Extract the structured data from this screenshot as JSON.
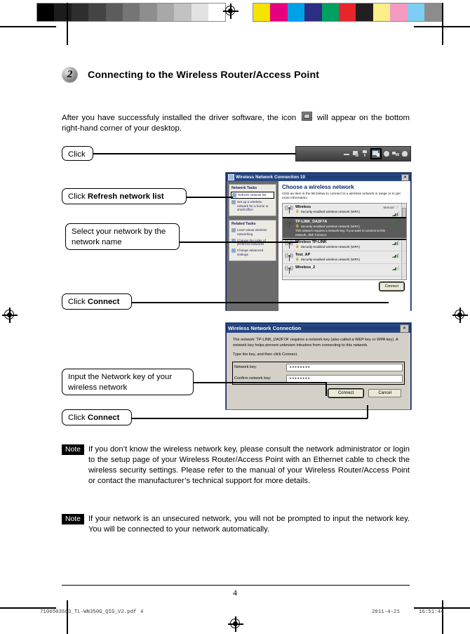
{
  "calibration": {
    "gray_swatches": [
      "#000000",
      "#1c1c1c",
      "#2e2e2e",
      "#444444",
      "#5c5c5c",
      "#757575",
      "#8e8e8e",
      "#a8a8a8",
      "#c2c2c2",
      "#e2e2e2",
      "#ffffff"
    ],
    "color_swatches": [
      "#f5e400",
      "#e5007f",
      "#00a0e9",
      "#2b2e83",
      "#00a060",
      "#e7262b",
      "#231f20",
      "#fbeE88",
      "#f49ac1",
      "#7ecef4",
      "#8c8c8c"
    ]
  },
  "section": {
    "number": "2",
    "title": "Connecting to the Wireless Router/Access Point"
  },
  "intro": {
    "before_icon": "After you have successfuly installed the driver software, the icon",
    "after_icon": "will appear on the bottom right-hand corner of your desktop."
  },
  "callouts": {
    "click_tray": "Click",
    "refresh_prefix": "Click ",
    "refresh_bold": "Refresh network list",
    "select_network": "Select your network by the network name",
    "connect1_prefix": "Click ",
    "connect1_bold": "Connect",
    "input_key": "Input the Network key of your wireless network",
    "connect2_prefix": "Click ",
    "connect2_bold": "Connect"
  },
  "browse_dialog": {
    "title": "Wireless Network Connection 10",
    "close_label": "×",
    "sidebar": {
      "group1_title": "Network Tasks",
      "group1_items": [
        "Refresh network list",
        "Set up a wireless network for a home or small office"
      ],
      "group2_title": "Related Tasks",
      "group2_items": [
        "Learn about wireless networking",
        "Change the order of preferred networks",
        "Change advanced settings"
      ]
    },
    "heading": "Choose a wireless network",
    "hint": "Click an item in the list below to connect to a wireless network in range or to get more information.",
    "networks": [
      {
        "name": "Wireless",
        "security": "Security-enabled wireless network (WPA)",
        "mode": "Manual",
        "signal": 4,
        "selected": false,
        "note": ""
      },
      {
        "name": "TP-LINK_DA2F7A",
        "security": "Security-enabled wireless network (WPA)",
        "mode": "",
        "signal": 5,
        "selected": true,
        "note": "This network requires a network key. If you want to connect to this network, click Connect."
      },
      {
        "name": "Wireless TP-LINK",
        "security": "Security-enabled wireless network (WPA)",
        "mode": "",
        "signal": 4,
        "selected": false,
        "note": ""
      },
      {
        "name": "Test_AP",
        "security": "Security-enabled wireless network (WPA)",
        "mode": "",
        "signal": 4,
        "selected": false,
        "note": ""
      },
      {
        "name": "Wireless_2",
        "security": "",
        "mode": "",
        "signal": 3,
        "selected": false,
        "note": ""
      }
    ],
    "connect_button": "Connect"
  },
  "key_dialog": {
    "title": "Wireless Network Connection",
    "close_label": "×",
    "message": "The network 'TP-LINK_DA2F7A' requires a network key (also called a WEP key or WPA key). A network key helps prevent unknown intruders from connecting to this network.",
    "instruction": "Type the key, and then click Connect.",
    "network_key_label": "Network key:",
    "network_key_value": "••••••••",
    "confirm_key_label": "Confirm network key:",
    "confirm_key_value": "••••••••",
    "connect_button": "Connect",
    "cancel_button": "Cancel"
  },
  "notes": [
    {
      "badge": "Note",
      "text": "If you don’t know the wireless network key, please consult the network administrator or login to the setup page of your Wireless Router/Access Point with an Ethernet cable to check the wireless security settings. Please refer to the manual of your Wireless Router/Access Point or contact the manufacturer’s technical support for more details."
    },
    {
      "badge": "Note",
      "text": "If your network is an unsecured network, you will not be prompted to input the network key. You will be connected to your network automatically."
    }
  ],
  "footer": {
    "page_number": "4",
    "file_name": "7106503563_TL-WN350G_QIG_V2.pdf",
    "print_page": "4",
    "date": "2011-4-21",
    "time": "16:51:44"
  }
}
